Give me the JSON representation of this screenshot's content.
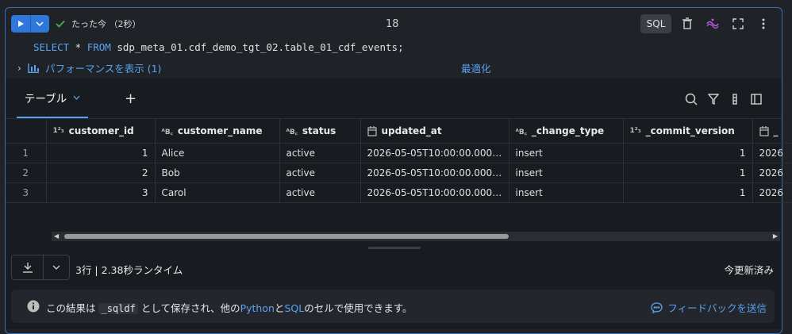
{
  "header": {
    "status_text": "たった今 （2秒）",
    "cell_number": "18",
    "language_badge": "SQL"
  },
  "code": {
    "select": "SELECT",
    "star": " * ",
    "from": "FROM",
    "table": " sdp_meta_01.cdf_demo_tgt_02.table_01_cdf_events;"
  },
  "perf": {
    "label": "パフォーマンスを表示 (1)",
    "optimize": "最適化"
  },
  "results": {
    "tab_label": "テーブル",
    "columns": [
      {
        "type_icon": "1²₃",
        "name": "customer_id"
      },
      {
        "type_icon": "ᴬB꜀",
        "name": "customer_name"
      },
      {
        "type_icon": "ᴬB꜀",
        "name": "status"
      },
      {
        "type_icon": "cal",
        "name": "updated_at"
      },
      {
        "type_icon": "ᴬB꜀",
        "name": "_change_type"
      },
      {
        "type_icon": "1²₃",
        "name": "_commit_version"
      },
      {
        "type_icon": "cal",
        "name": "_"
      }
    ],
    "rows": [
      {
        "n": "1",
        "customer_id": "1",
        "customer_name": "Alice",
        "status": "active",
        "updated_at": "2026-05-05T10:00:00.000+00:...",
        "change_type": "insert",
        "commit_version": "1",
        "extra": "2026"
      },
      {
        "n": "2",
        "customer_id": "2",
        "customer_name": "Bob",
        "status": "active",
        "updated_at": "2026-05-05T10:00:00.000+00:...",
        "change_type": "insert",
        "commit_version": "1",
        "extra": "2026"
      },
      {
        "n": "3",
        "customer_id": "3",
        "customer_name": "Carol",
        "status": "active",
        "updated_at": "2026-05-05T10:00:00.000+00:...",
        "change_type": "insert",
        "commit_version": "1",
        "extra": "2026"
      }
    ],
    "row_info": "3行 | 2.38秒ランタイム",
    "updated": "今更新済み"
  },
  "notice": {
    "pre": "この結果は ",
    "varname": "_sqldf",
    "mid": " として保存され、他の",
    "python": "Python",
    "and": "と",
    "sql": "SQL",
    "post": "のセルで使用できます。",
    "feedback": "フィードバックを送信"
  },
  "colors": {
    "accent": "#2f78d9",
    "link": "#5aa2f0",
    "background": "#1f2328"
  }
}
